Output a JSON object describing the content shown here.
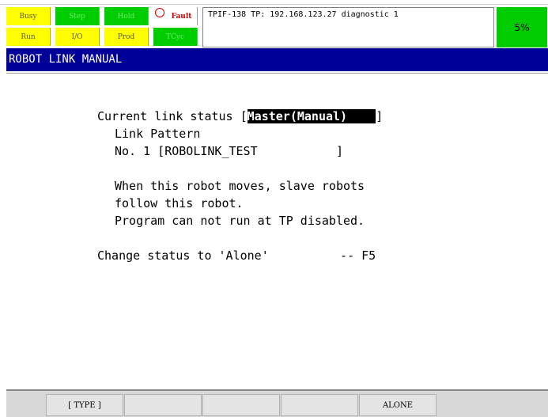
{
  "indicators": {
    "row1": [
      {
        "label": "Busy",
        "color": "#ffff00"
      },
      {
        "label": "Step",
        "color": "#00cc00"
      },
      {
        "label": "Hold",
        "color": "#00cc00"
      },
      {
        "label": "Fault",
        "color": "#ffffff"
      }
    ],
    "row2": [
      {
        "label": "Run",
        "color": "#ffff00"
      },
      {
        "label": "I/O",
        "color": "#ffff00"
      },
      {
        "label": "Prod",
        "color": "#ffff00"
      },
      {
        "label": "TCyc",
        "color": "#00cc00"
      }
    ]
  },
  "message": "TPIF-138 TP: 192.168.123.27 diagnostic 1",
  "override": "5%",
  "screen_title": "ROBOT LINK MANUAL",
  "content": {
    "status_prefix": "Current link status [",
    "status_value": "Master(Manual)    ",
    "status_suffix": "]",
    "link_pattern_label": "Link Pattern",
    "link_pattern_value": "No. 1 [ROBOLINK_TEST           ]",
    "desc1": "When this robot moves, slave robots",
    "desc2": "follow this robot.",
    "desc3": "Program can not run at TP disabled.",
    "change_status": "Change status to 'Alone'          -- F5"
  },
  "function_keys": {
    "f1": "[ TYPE ]",
    "f2": "",
    "f3": "",
    "f4": "",
    "f5": "ALONE"
  }
}
